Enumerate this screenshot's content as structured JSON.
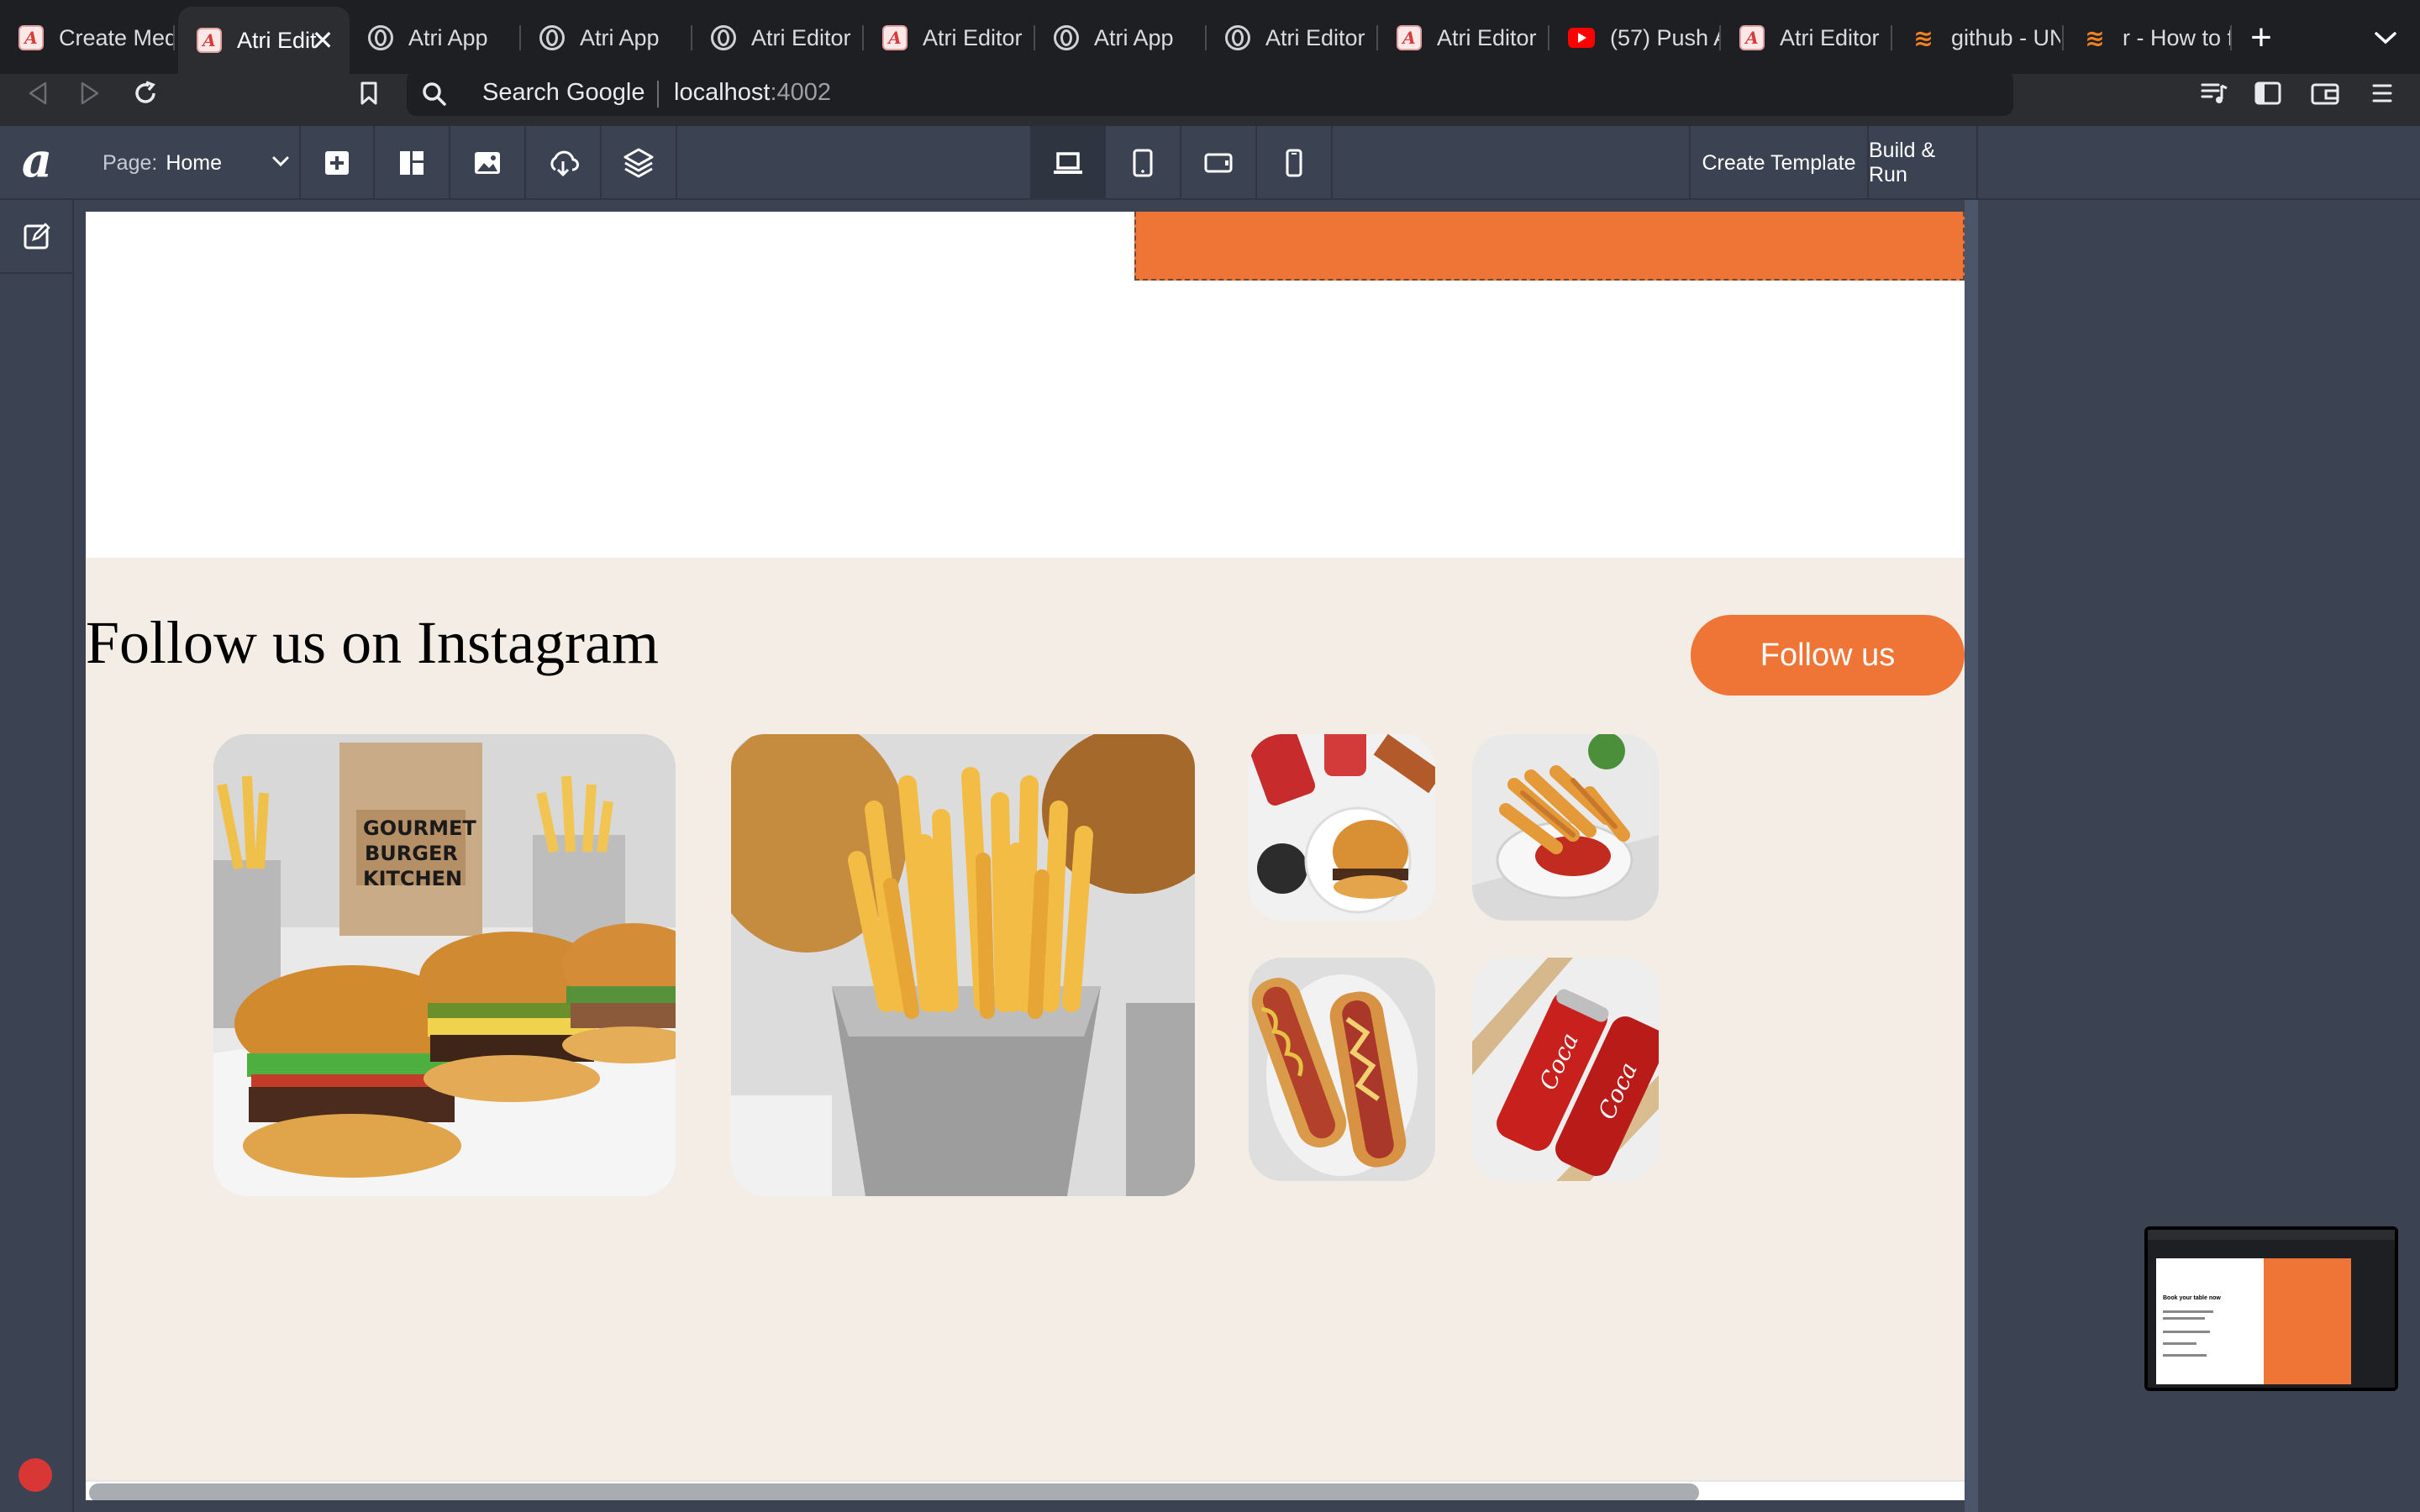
{
  "browser": {
    "tabs": [
      {
        "title": "Create Med",
        "favicon": "atri-icon",
        "active": false
      },
      {
        "title": "Atri Edit",
        "favicon": "atri-icon",
        "active": true
      },
      {
        "title": "Atri App",
        "favicon": "globe-icon",
        "active": false
      },
      {
        "title": "Atri App",
        "favicon": "globe-icon",
        "active": false
      },
      {
        "title": "Atri Editor",
        "favicon": "globe-icon",
        "active": false
      },
      {
        "title": "Atri Editor",
        "favicon": "atri-icon",
        "active": false
      },
      {
        "title": "Atri App",
        "favicon": "globe-icon",
        "active": false
      },
      {
        "title": "Atri Editor",
        "favicon": "globe-icon",
        "active": false
      },
      {
        "title": "Atri Editor",
        "favicon": "atri-icon",
        "active": false
      },
      {
        "title": "(57) Push A",
        "favicon": "youtube-icon",
        "active": false
      },
      {
        "title": "Atri Editor",
        "favicon": "atri-icon",
        "active": false
      },
      {
        "title": "github - UN",
        "favicon": "stackoverflow-icon",
        "active": false
      },
      {
        "title": "r - How to f",
        "favicon": "stackoverflow-icon",
        "active": false
      }
    ],
    "omnibox": {
      "label": "Search Google",
      "host": "localhost",
      "port": ":4002"
    }
  },
  "editor": {
    "logo": "a",
    "page_select": {
      "label": "Page:",
      "value": "Home"
    },
    "create_template_label": "Create Template",
    "build_run_label": "Build & Run",
    "selected_device": "desktop"
  },
  "canvas": {
    "instagram": {
      "title": "Follow us on Instagram",
      "follow_label": "Follow us"
    },
    "accent_color": "#ee7536",
    "section_bg": "#f4ede6"
  },
  "minimap": {
    "title": "Book your table now"
  }
}
